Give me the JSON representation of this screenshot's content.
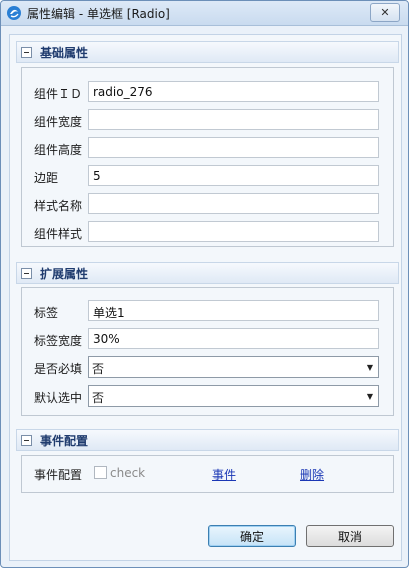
{
  "window": {
    "title": "属性编辑 - 单选框 [Radio]",
    "close_symbol": "✕"
  },
  "sections": {
    "basic": {
      "title": "基础属性",
      "fields": [
        {
          "label": "组件ＩＤ",
          "value": "radio_276"
        },
        {
          "label": "组件宽度",
          "value": ""
        },
        {
          "label": "组件高度",
          "value": ""
        },
        {
          "label": "边距",
          "value": "5"
        },
        {
          "label": "样式名称",
          "value": ""
        },
        {
          "label": "组件样式",
          "value": ""
        }
      ]
    },
    "extended": {
      "title": "扩展属性",
      "fields": [
        {
          "label": "标签",
          "value": "单选1"
        },
        {
          "label": "标签宽度",
          "value": "30%"
        }
      ],
      "selects": [
        {
          "label": "是否必填",
          "value": "否"
        },
        {
          "label": "默认选中",
          "value": "否"
        }
      ]
    },
    "events": {
      "title": "事件配置",
      "row_label": "事件配置",
      "checkbox_label": "check",
      "event_link": "事件",
      "delete_link": "删除"
    }
  },
  "buttons": {
    "ok": "确定",
    "cancel": "取消"
  },
  "colors": {
    "titlebar": "#c9dbef",
    "accent": "#1f3b6e",
    "link": "#1a37b5"
  },
  "icons": {
    "app": "app-logo-icon",
    "collapse": "collapse-icon",
    "dropdown": "chevron-down-icon"
  }
}
